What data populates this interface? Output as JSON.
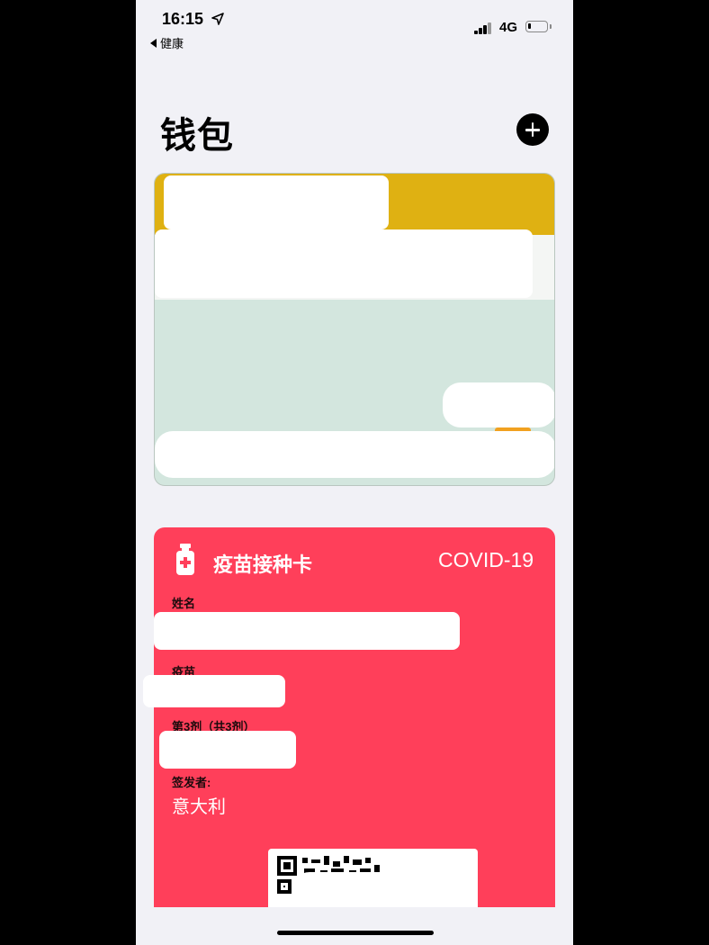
{
  "status_bar": {
    "time": "16:15",
    "back_app": "健康",
    "network": "4G"
  },
  "header": {
    "title": "钱包",
    "add_icon": "plus-circle-icon"
  },
  "card_stack": {
    "top_card_colors": [
      "#dfb112",
      "#f4f6f4",
      "#d3e6de"
    ],
    "symbol": ")"
  },
  "vaccine_card": {
    "title": "疫苗接种卡",
    "type": "COVID-19",
    "icon": "vaccine-vial-icon",
    "color": "#ff3f5a",
    "fields": {
      "name_label": "姓名",
      "vaccine_label": "疫苗",
      "dose_label": "第3剂（共3剂）",
      "issuer_label": "签发者:",
      "issuer_value": "意大利"
    }
  }
}
